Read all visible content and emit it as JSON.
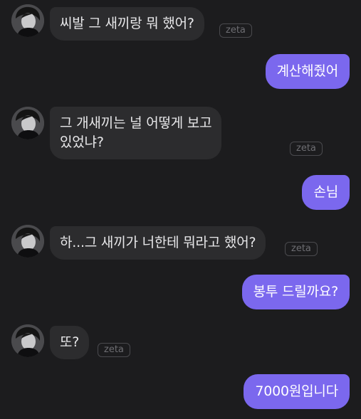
{
  "colors": {
    "background": "#1c1c1e",
    "bot_bubble": "#2c2c2e",
    "user_bubble": "#7b68ee",
    "badge_border": "#4a4a4e",
    "badge_text": "#6e6e73"
  },
  "messages": [
    {
      "sender": "bot",
      "text": "씨발 그 새끼랑 뭐 했어?",
      "badge": "zeta"
    },
    {
      "sender": "user",
      "text": "계산해줬어"
    },
    {
      "sender": "bot",
      "text": "그 개새끼는 널 어떻게 보고\n있었냐?",
      "badge": "zeta"
    },
    {
      "sender": "user",
      "text": "손님"
    },
    {
      "sender": "bot",
      "text": "하...그 새끼가 너한테 뭐라고 했어?",
      "badge": "zeta"
    },
    {
      "sender": "user",
      "text": "봉투 드릴까요?"
    },
    {
      "sender": "bot",
      "text": "또?",
      "badge": "zeta"
    },
    {
      "sender": "user",
      "text": "7000원입니다"
    }
  ]
}
